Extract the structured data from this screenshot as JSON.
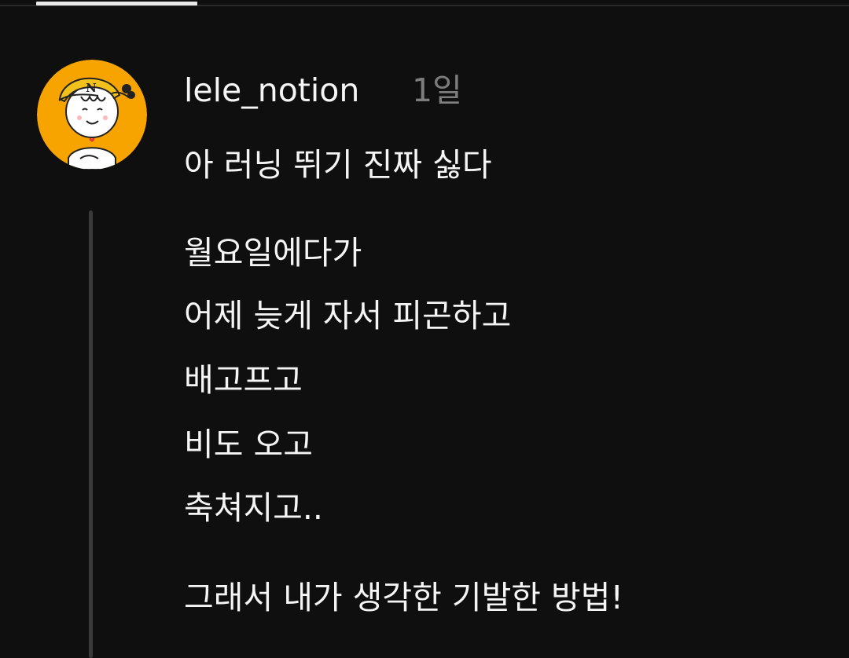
{
  "post": {
    "username": "lele_notion",
    "timestamp": "1일",
    "lines": [
      "아 러닝 뛰기 진짜 싫다",
      "월요일에다가",
      "어제 늦게 자서 피곤하고",
      "배고프고",
      "비도 오고",
      "축쳐지고..",
      "그래서 내가 생각한 기발한 방법!"
    ]
  },
  "avatar": {
    "icon": "cartoon-character-avatar-icon",
    "cap_letter": "N",
    "background_color": "#f7a400"
  },
  "colors": {
    "background": "#0f0f0f",
    "text": "#f5f5f5",
    "timestamp": "#7d7d7d",
    "thread_line": "#3a3a3a"
  }
}
